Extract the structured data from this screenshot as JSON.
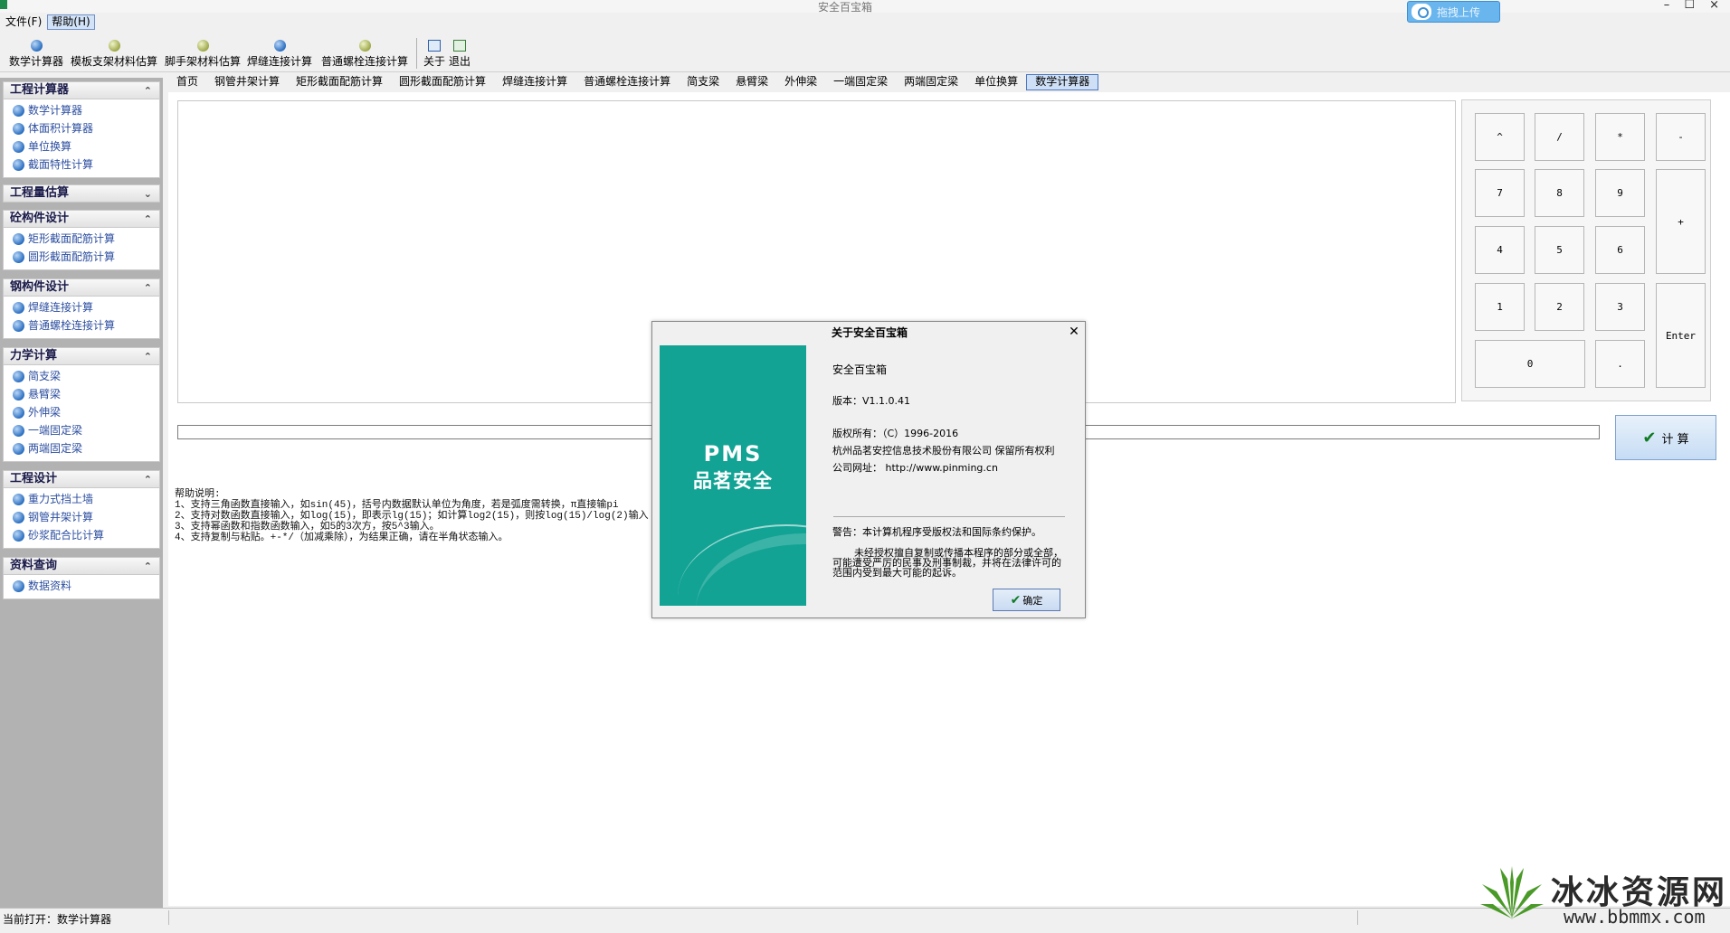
{
  "window": {
    "title": "安全百宝箱",
    "controls": "– ☐ ×"
  },
  "menu": [
    "文件(F)",
    "帮助(H)"
  ],
  "upload_button": "拖拽上传",
  "toolbar": {
    "buttons": [
      "数学计算器",
      "模板支架材料估算",
      "脚手架材料估算",
      "焊缝连接计算",
      "普通螺栓连接计算"
    ],
    "about": "关于",
    "exit": "退出"
  },
  "sidebar": {
    "groups": [
      {
        "title": "工程计算器",
        "chevron": "⌃",
        "items": [
          "数学计算器",
          "体面积计算器",
          "单位换算",
          "截面特性计算"
        ]
      },
      {
        "title": "工程量估算",
        "chevron": "⌄",
        "items": []
      },
      {
        "title": "砼构件设计",
        "chevron": "⌃",
        "items": [
          "矩形截面配筋计算",
          "圆形截面配筋计算"
        ]
      },
      {
        "title": "钢构件设计",
        "chevron": "⌃",
        "items": [
          "焊缝连接计算",
          "普通螺栓连接计算"
        ]
      },
      {
        "title": "力学计算",
        "chevron": "⌃",
        "items": [
          "简支梁",
          "悬臂梁",
          "外伸梁",
          "一端固定梁",
          "两端固定梁"
        ]
      },
      {
        "title": "工程设计",
        "chevron": "⌃",
        "items": [
          "重力式挡土墙",
          "钢管井架计算",
          "砂浆配合比计算"
        ]
      },
      {
        "title": "资料查询",
        "chevron": "⌃",
        "items": [
          "数据资料"
        ]
      }
    ]
  },
  "tabs": [
    "首页",
    "钢管井架计算",
    "矩形截面配筋计算",
    "圆形截面配筋计算",
    "焊缝连接计算",
    "普通螺栓连接计算",
    "简支梁",
    "悬臂梁",
    "外伸梁",
    "一端固定梁",
    "两端固定梁",
    "单位换算",
    "数学计算器"
  ],
  "active_tab": "数学计算器",
  "keypad": {
    "keys": [
      "^",
      "/",
      "*",
      "-",
      "7",
      "8",
      "9",
      "+",
      "4",
      "5",
      "6",
      "1",
      "2",
      "3",
      "Enter",
      "0",
      "."
    ]
  },
  "calc_button": "计 算",
  "help": {
    "title": "帮助说明:",
    "lines": [
      "1、支持三角函数直接输入，如sin(45)，括号内数据默认单位为角度，若是弧度需转换，π直接输pi",
      "2、支持对数函数直接输入，如log(15)，即表示lg(15)；如计算log2(15)，则按log(15)/log(2)输入",
      "3、支持幂函数和指数函数输入，如5的3次方，按5^3输入。",
      "4、支持复制与粘贴。+-*/（加减乘除），为结果正确，请在半角状态输入。"
    ]
  },
  "dialog": {
    "title": "关于安全百宝箱",
    "brand_en": "PMS",
    "brand_cn": "品茗安全",
    "app_name": "安全百宝箱",
    "version": "版本：V1.1.0.41",
    "copyright": "版权所有：（C）1996-2016",
    "company": "杭州品茗安控信息技术股份有限公司 保留所有权利",
    "website": "公司网址：  http://www.pinming.cn",
    "warning": "警告：本计算机程序受版权法和国际条约保护。",
    "warning_detail": "未经授权擅自复制或传播本程序的部分或全部，可能遭受严厉的民事及刑事制裁，并将在法律许可的范围内受到最大可能的起诉。",
    "ok": "确定"
  },
  "status": {
    "current": "当前打开：数学计算器"
  },
  "watermark": {
    "name": "冰冰资源网",
    "url": "www.bbmmx.com"
  },
  "colors": {
    "brand_teal": "#12a394",
    "link_blue": "#2d4fa0",
    "upload_blue": "#69b5ee"
  }
}
